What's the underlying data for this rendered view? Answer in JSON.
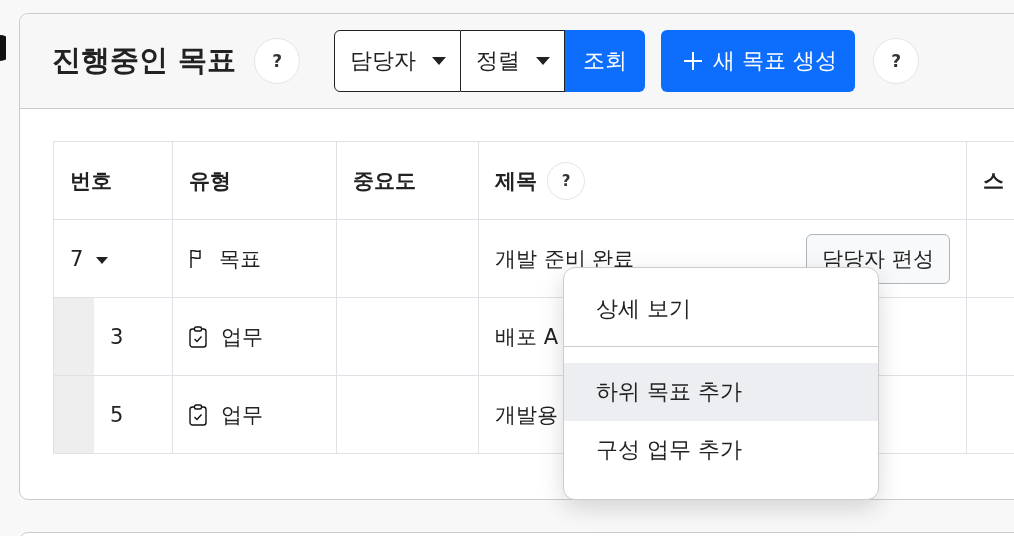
{
  "header": {
    "title": "진행중인 목표",
    "help": "?",
    "filters": [
      {
        "label": "담당자",
        "kind": "dropdown"
      },
      {
        "label": "정렬",
        "kind": "dropdown"
      },
      {
        "label": "조회",
        "kind": "submit"
      }
    ],
    "create_button": "새 목표 생성",
    "help_end": "?"
  },
  "table": {
    "columns": [
      {
        "label": "번호"
      },
      {
        "label": "유형"
      },
      {
        "label": "중요도"
      },
      {
        "label": "제목",
        "help": "?"
      },
      {
        "label": "스"
      }
    ],
    "rows": [
      {
        "number": "7",
        "expanded": true,
        "kind": "goal",
        "type": "목표",
        "title": "개발 준비 완료",
        "action": "담당자 편성",
        "children": [
          {
            "number": "3",
            "kind": "task",
            "type": "업무",
            "title": "배포 A"
          },
          {
            "number": "5",
            "kind": "task",
            "type": "업무",
            "title": "개발용"
          }
        ]
      }
    ]
  },
  "context_menu": {
    "groups": [
      [
        {
          "label": "상세 보기",
          "highlighted": false
        }
      ],
      [
        {
          "label": "하위 목표 추가",
          "highlighted": true
        },
        {
          "label": "구성 업무 추가",
          "highlighted": false
        }
      ]
    ]
  }
}
